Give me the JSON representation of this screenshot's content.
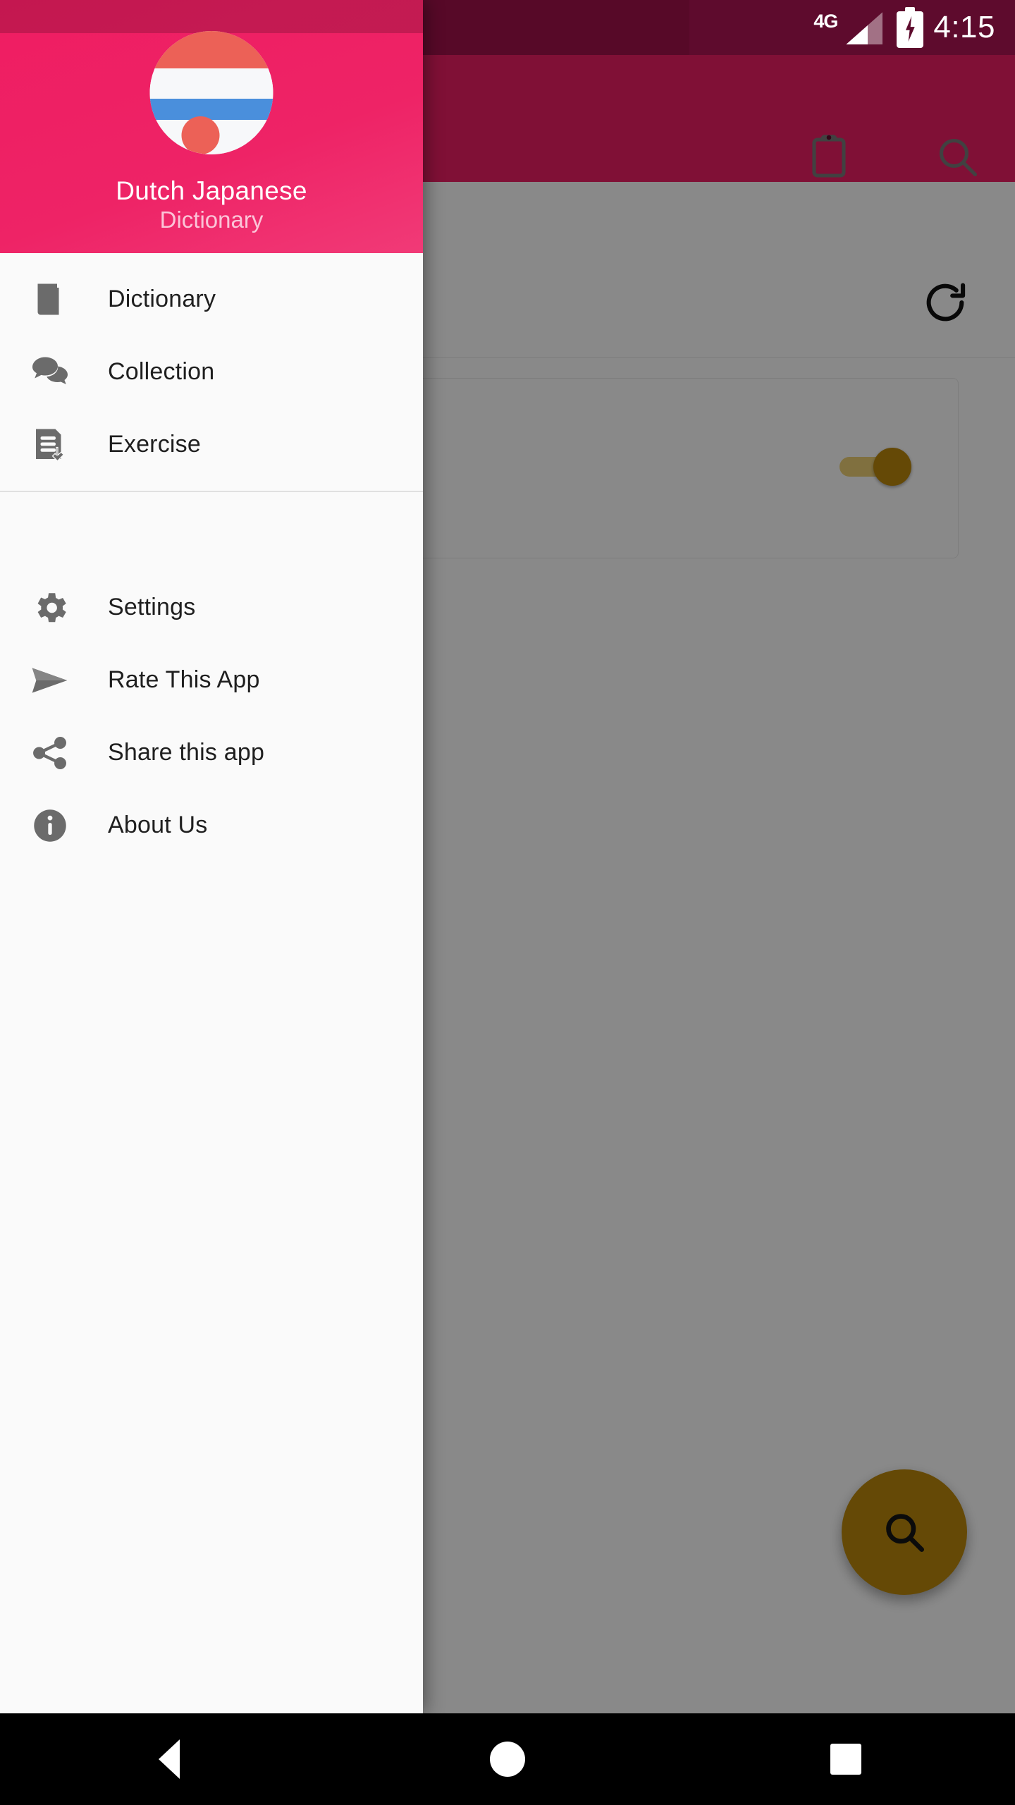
{
  "status_bar": {
    "network_label": "4G",
    "battery_icon": "battery-charging-icon",
    "signal_icon": "signal-bars-icon",
    "clock": "4:15"
  },
  "background_app": {
    "appbar": {
      "clipboard_icon": "clipboard-icon",
      "search_icon": "search-icon"
    },
    "refresh_icon": "refresh-icon",
    "toggle": {
      "name": "setting-toggle",
      "state": "on",
      "color": "#b8860b"
    },
    "fab": {
      "icon": "search-icon",
      "color": "#b8860b"
    }
  },
  "drawer": {
    "header": {
      "avatar_icon": "dutch-japanese-flag-avatar",
      "title": "Dutch  Japanese",
      "subtitle": "Dictionary",
      "background_color": "#ee2366"
    },
    "primary_items": [
      {
        "label": "Dictionary",
        "icon": "book-icon"
      },
      {
        "label": "Collection",
        "icon": "chat-bubbles-icon"
      },
      {
        "label": "Exercise",
        "icon": "document-check-icon"
      }
    ],
    "secondary_items": [
      {
        "label": "Settings",
        "icon": "gear-icon"
      },
      {
        "label": "Rate This App",
        "icon": "send-icon"
      },
      {
        "label": "Share this app",
        "icon": "share-icon"
      },
      {
        "label": "About Us",
        "icon": "info-icon"
      }
    ]
  },
  "navigation_bar": {
    "back": "back-triangle-icon",
    "home": "home-circle-icon",
    "recents": "recents-square-icon"
  }
}
